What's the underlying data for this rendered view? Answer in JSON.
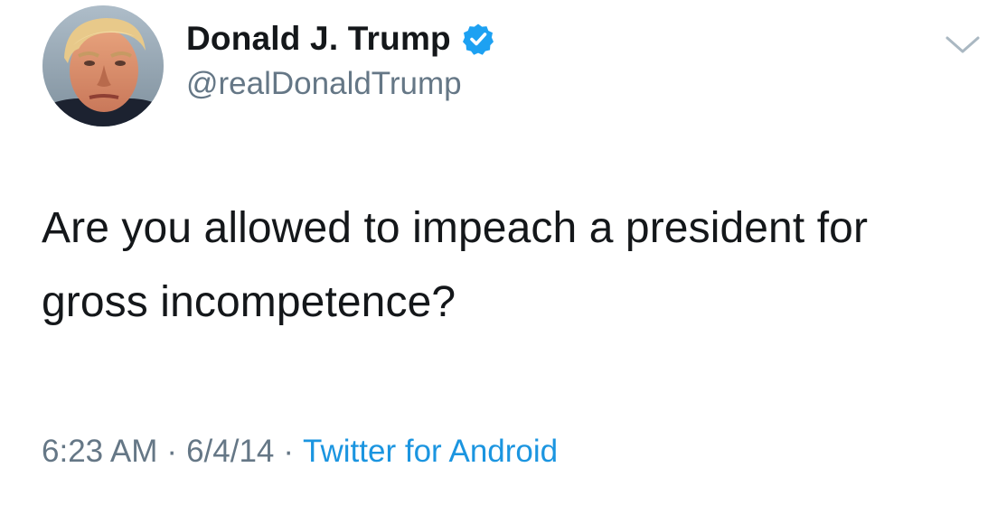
{
  "author": {
    "display_name": "Donald J. Trump",
    "handle": "@realDonaldTrump",
    "verified": true,
    "verified_icon": "verified-badge-icon",
    "avatar": "profile-photo"
  },
  "menu": {
    "icon": "chevron-down-icon"
  },
  "tweet": {
    "text": "Are you allowed to impeach a president for gross incompetence?"
  },
  "meta": {
    "time": "6:23 AM",
    "separator": "·",
    "date": "6/4/14",
    "source": "Twitter for Android"
  },
  "colors": {
    "text_primary": "#14171a",
    "text_secondary": "#657786",
    "link": "#1b95e0",
    "verified": "#1da1f2"
  }
}
